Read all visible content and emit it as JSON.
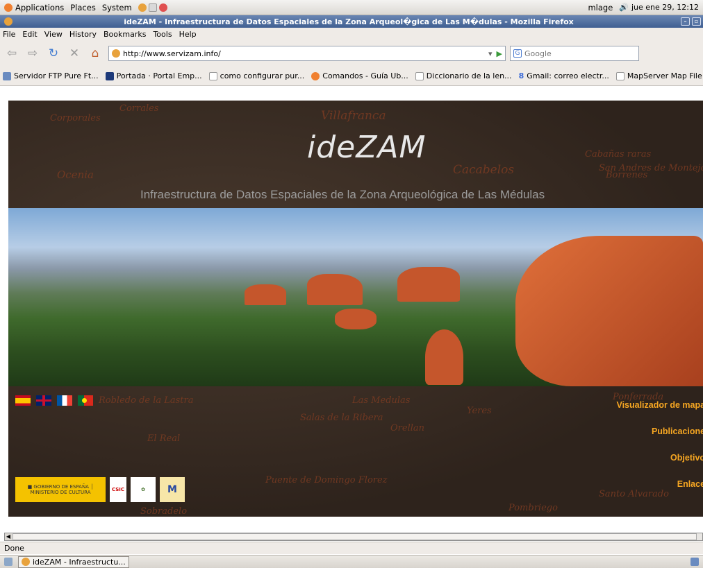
{
  "topbar": {
    "menus": [
      "Applications",
      "Places",
      "System"
    ],
    "user": "mlage",
    "datetime": "jue ene 29, 12:12"
  },
  "window": {
    "title": "ideZAM - Infraestructura de Datos Espaciales de la Zona Arqueol�gica de Las M�dulas - Mozilla Firefox"
  },
  "menubar": [
    "File",
    "Edit",
    "View",
    "History",
    "Bookmarks",
    "Tools",
    "Help"
  ],
  "nav": {
    "url": "http://www.servizam.info/",
    "search_placeholder": "Google"
  },
  "bookmarks": [
    "Servidor FTP Pure Ft...",
    "Portada · Portal Emp...",
    "como configurar pur...",
    "Comandos - Guía Ub...",
    "Diccionario de la len...",
    "Gmail: correo electr...",
    "MapServer Map File ..."
  ],
  "page": {
    "logo": "ideZAM",
    "subtitle": "Infraestructura de Datos Espaciales de la Zona Arqueológica de Las Médulas",
    "links": [
      "Visualizador de mapas",
      "Publicaciones",
      "Objetivos",
      "Enlaces"
    ],
    "link_color": "#f7a722",
    "map_labels": [
      "Corporales",
      "Corrales",
      "Villafranca",
      "Cacabelos",
      "Ocenia",
      "Orellan",
      "Robledo de la Lastra",
      "Las Medulas",
      "Yeres",
      "Salas de la Ribera",
      "Puente de Domingo Florez",
      "Borrenes",
      "Cabañas raras",
      "San Andres de Montejos",
      "Santo Alvarado",
      "Ponferrada",
      "El Real",
      "Pombriego",
      "Sobradelo"
    ]
  },
  "status": {
    "text": "Done"
  },
  "taskbar": {
    "window_label": "ideZAM - Infraestructu..."
  }
}
